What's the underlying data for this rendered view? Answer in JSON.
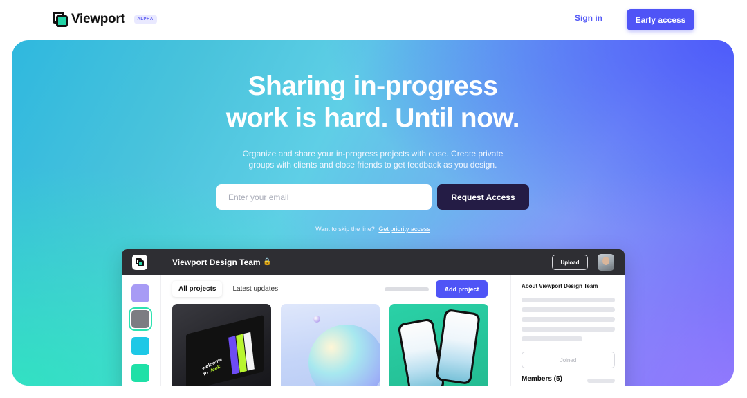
{
  "nav": {
    "logo_text": "Viewport",
    "badge": "ALPHA",
    "signin_label": "Sign in",
    "early_access_label": "Early access"
  },
  "hero": {
    "headline_line1": "Sharing in-progress",
    "headline_line2": "work is hard. Until now.",
    "subtitle_line1": "Organize and share your in-progress projects with ease. Create private",
    "subtitle_line2": "groups with clients and close friends to get feedback as you design.",
    "email_placeholder": "Enter your email",
    "request_label": "Request Access",
    "skip_text": "Want to skip the line?",
    "priority_link": "Get priority access"
  },
  "app": {
    "team_name": "Viewport Design Team",
    "upload_label": "Upload",
    "tabs": [
      {
        "label": "All projects"
      },
      {
        "label": "Latest updates"
      }
    ],
    "add_project_label": "Add project",
    "card1_text_a": "welcome",
    "card1_text_b": "to ",
    "card1_text_c": "deck.",
    "sidebar": {
      "about_title": "About Viewport Design Team",
      "joined_label": "Joined",
      "members_label": "Members (5)"
    }
  },
  "colors": {
    "accent": "#4f54f6",
    "dark_button": "#241c45",
    "app_bar": "#2e2e33"
  }
}
